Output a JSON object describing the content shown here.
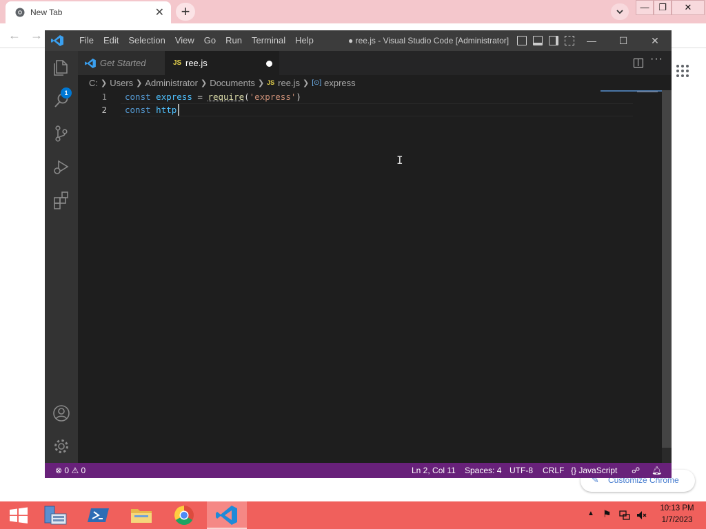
{
  "chrome": {
    "tab_title": "New Tab",
    "tab_close": "✕",
    "new_tab": "+",
    "customize_label": "Customize Chrome"
  },
  "window_controls": {
    "minimize": "—",
    "restore": "❐",
    "close": "✕"
  },
  "vscode": {
    "menu": [
      "File",
      "Edit",
      "Selection",
      "View",
      "Go",
      "Run",
      "Terminal",
      "Help"
    ],
    "window_title": "● ree.js - Visual Studio Code [Administrator]",
    "title_controls": {
      "minimize": "—",
      "maximize": "☐",
      "close": "✕"
    },
    "activity_badge": "1",
    "tabs": [
      {
        "label": "Get Started",
        "active": false
      },
      {
        "label": "ree.js",
        "icon": "JS",
        "active": true,
        "dirty": true
      }
    ],
    "breadcrumb": [
      "C:",
      "Users",
      "Administrator",
      "Documents",
      "ree.js",
      "express"
    ],
    "breadcrumb_js_icon": "JS",
    "breadcrumb_symbol_icon": "[⊙]",
    "editor": {
      "lines": [
        {
          "number": "1",
          "tokens": {
            "kw": "const",
            "name": "express",
            "op": " = ",
            "fn": "require",
            "open": "(",
            "str": "'express'",
            "close": ")"
          }
        },
        {
          "number": "2",
          "tokens": {
            "kw": "const",
            "name": "http"
          }
        }
      ]
    },
    "status": {
      "errors": "0",
      "warnings": "0",
      "position": "Ln 2, Col 11",
      "spaces": "Spaces: 4",
      "encoding": "UTF-8",
      "eol": "CRLF",
      "language_icon": "{}",
      "language": "JavaScript"
    }
  },
  "taskbar": {
    "time": "10:13 PM",
    "date": "1/7/2023"
  }
}
